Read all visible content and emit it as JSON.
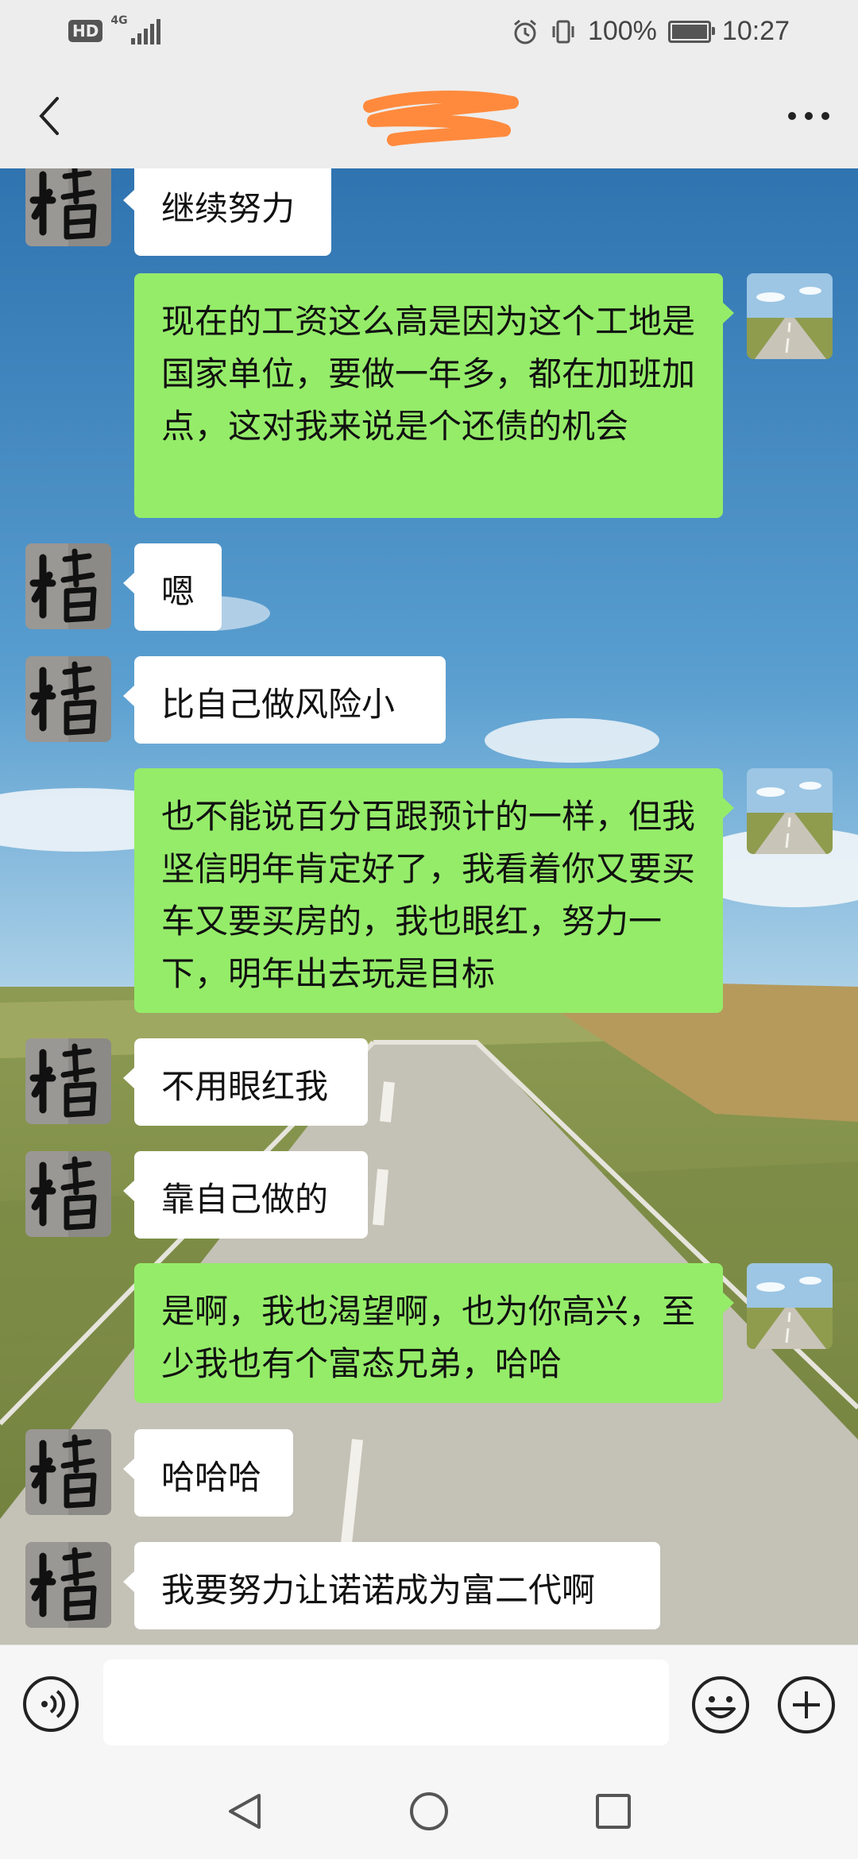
{
  "status_bar": {
    "hd_label": "HD",
    "network_label": "4G",
    "battery_text": "100%",
    "time": "10:27",
    "battery_level": 1.0
  },
  "header": {
    "title": "",
    "back_icon": "chevron-left-icon",
    "more_icon": "more-dots-icon"
  },
  "messages": [
    {
      "side": "left",
      "text": "继续努力"
    },
    {
      "side": "right",
      "text": "现在的工资这么高是因为这个工地是国家单位，要做一年多，都在加班加点，这对我来说是个还债的机会"
    },
    {
      "side": "left",
      "text": "嗯"
    },
    {
      "side": "left",
      "text": "比自己做风险小"
    },
    {
      "side": "right",
      "text": "也不能说百分百跟预计的一样，但我坚信明年肯定好了，我看着你又要买车又要买房的，我也眼红，努力一下，明年出去玩是目标"
    },
    {
      "side": "left",
      "text": "不用眼红我"
    },
    {
      "side": "left",
      "text": "靠自己做的"
    },
    {
      "side": "right",
      "text": "是啊，我也渴望啊，也为你高兴，至少我也有个富态兄弟，哈哈"
    },
    {
      "side": "left",
      "text": "哈哈哈"
    },
    {
      "side": "left",
      "text": "我要努力让诺诺成为富二代啊"
    }
  ],
  "input_bar": {
    "placeholder": "",
    "voice_icon": "voice-icon",
    "emoji_icon": "emoji-icon",
    "plus_icon": "plus-icon"
  },
  "nav_bar": {
    "back_icon": "triangle-back-icon",
    "home_icon": "circle-home-icon",
    "recents_icon": "square-recents-icon"
  },
  "colors": {
    "self_bubble": "#95ec69",
    "other_bubble": "#ffffff",
    "chrome": "#ededed",
    "redaction": "#ff8a3d"
  }
}
